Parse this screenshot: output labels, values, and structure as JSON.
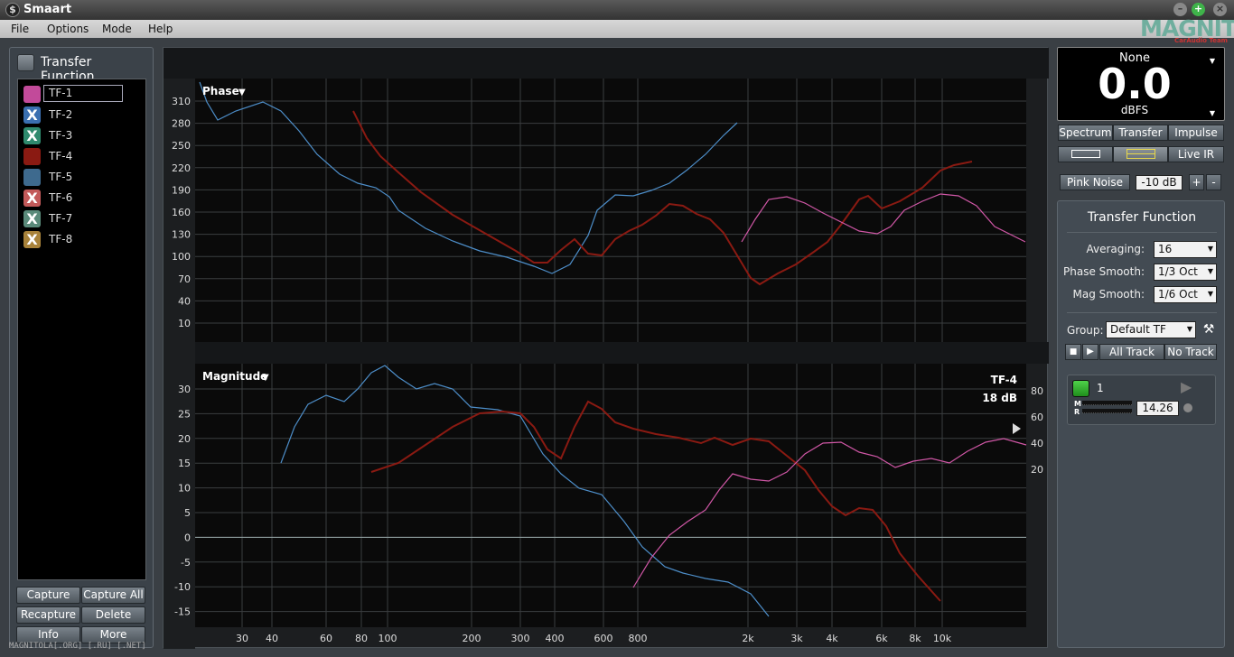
{
  "window": {
    "title": "Smaart"
  },
  "menu": [
    "File",
    "Options",
    "Mode",
    "Help"
  ],
  "logo": {
    "text": "MAGNITOLA",
    "sub": "CarAudio Team"
  },
  "left": {
    "header": "Transfer Function",
    "items": [
      {
        "name": "TF-1",
        "color": "#c24a9a",
        "hidden": false,
        "editing": true
      },
      {
        "name": "TF-2",
        "color": "#3a6fb0",
        "hidden": true
      },
      {
        "name": "TF-3",
        "color": "#2f8a6e",
        "hidden": true
      },
      {
        "name": "TF-4",
        "color": "#8a1a12",
        "hidden": false
      },
      {
        "name": "TF-5",
        "color": "#3e6a8e",
        "hidden": false
      },
      {
        "name": "TF-6",
        "color": "#c35a5a",
        "hidden": true
      },
      {
        "name": "TF-7",
        "color": "#5a8a7a",
        "hidden": true
      },
      {
        "name": "TF-8",
        "color": "#a8823a",
        "hidden": true
      }
    ],
    "buttons": {
      "capture": "Capture",
      "capture_all": "Capture All",
      "recapture": "Recapture",
      "delete": "Delete",
      "info": "Info",
      "more": "More"
    }
  },
  "watermark": "MAGNITOLA[.ORG] [.RU] [.NET]",
  "phase_plot": {
    "title": "Phase",
    "y_ticks": [
      310,
      280,
      250,
      220,
      190,
      160,
      130,
      100,
      70,
      40,
      10
    ],
    "x_ticks": [
      "30",
      "40",
      "60",
      "80",
      "100",
      "200",
      "300",
      "400",
      "600",
      "800",
      "2k",
      "3k",
      "4k",
      "6k",
      "8k",
      "10k"
    ]
  },
  "magnitude_plot": {
    "title": "Magnitude",
    "y_ticks": [
      30,
      25,
      20,
      15,
      10,
      5,
      0,
      -5,
      -10,
      -15
    ],
    "right_ticks": [
      80,
      60,
      40,
      20
    ],
    "x_ticks": [
      "30",
      "40",
      "60",
      "80",
      "100",
      "200",
      "300",
      "400",
      "600",
      "800",
      "2k",
      "3k",
      "4k",
      "6k",
      "8k",
      "10k"
    ],
    "active_trace": "TF-4",
    "active_offset": "18 dB"
  },
  "meter": {
    "top": "None",
    "value": "0.0",
    "unit": "dBFS"
  },
  "modes": {
    "spectrum": "Spectrum",
    "transfer": "Transfer",
    "impulse": "Impulse",
    "live_ir": "Live IR"
  },
  "generator": {
    "label": "Pink Noise",
    "level": "-10 dB",
    "plus": "+",
    "minus": "-"
  },
  "tf_panel": {
    "title": "Transfer Function",
    "averaging_label": "Averaging:",
    "averaging": "16",
    "phase_smooth_label": "Phase Smooth:",
    "phase_smooth": "1/3 Oct",
    "mag_smooth_label": "Mag Smooth:",
    "mag_smooth": "1/6 Oct",
    "group_label": "Group:",
    "group": "Default TF",
    "all_track": "All Track",
    "no_track": "No Track",
    "channel": {
      "name": "1",
      "m": "M",
      "r": "R",
      "delay": "14.26"
    }
  }
}
